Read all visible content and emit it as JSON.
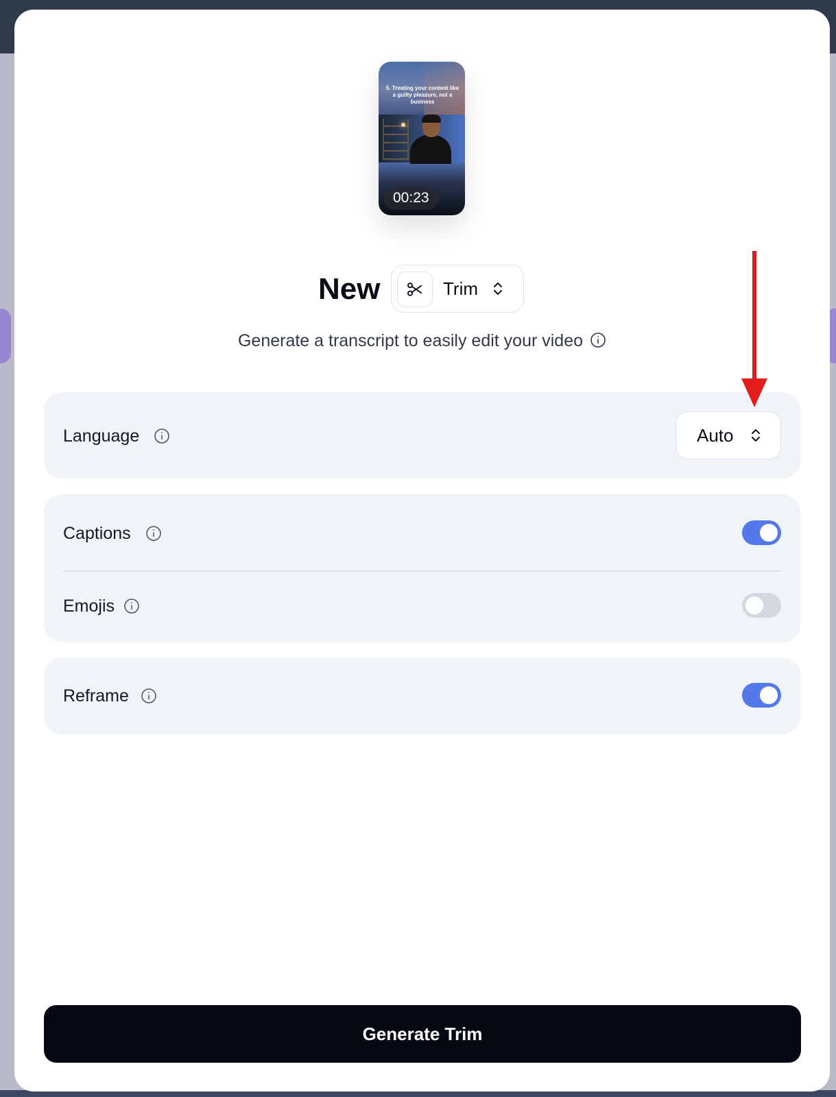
{
  "modal": {
    "video": {
      "caption": "5. Treating your content like a guilty pleasure, not a business",
      "duration": "00:23"
    },
    "title": "New",
    "mode_select": {
      "value": "Trim",
      "icon": "scissors-icon"
    },
    "subtitle": "Generate a transcript to easily edit your video",
    "settings": {
      "language": {
        "label": "Language",
        "value": "Auto"
      },
      "captions": {
        "label": "Captions",
        "enabled": true
      },
      "emojis": {
        "label": "Emojis",
        "enabled": false
      },
      "reframe": {
        "label": "Reframe",
        "enabled": true
      }
    },
    "generate_button": "Generate Trim"
  },
  "colors": {
    "accent": "#5378ea",
    "toggle_off": "#d3d8e1",
    "card_bg": "#f0f3f8",
    "primary_button": "#060914",
    "annotation_arrow": "#e31b1b"
  }
}
